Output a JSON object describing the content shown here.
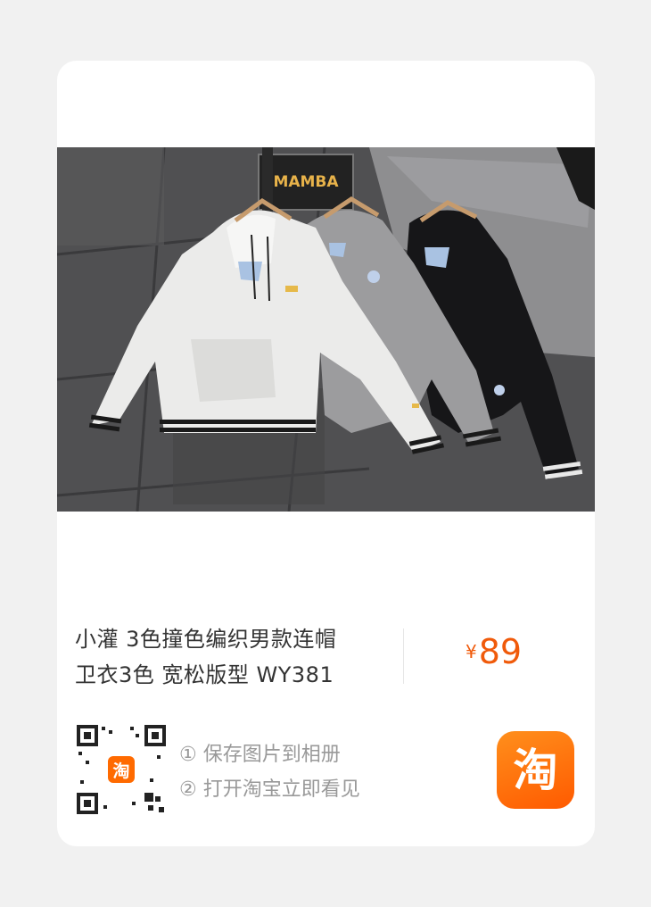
{
  "product": {
    "title_line1": "小灌 3色撞色编织男款连帽",
    "title_line2": "卫衣3色 宽松版型 WY381",
    "currency": "¥",
    "price": "89"
  },
  "photo": {
    "sign_text": "MAMBA",
    "hoodie_colors": [
      "white",
      "grey",
      "black"
    ]
  },
  "qr_code": {
    "badge_text": "淘"
  },
  "instructions": {
    "step1": "① 保存图片到相册",
    "step2": "② 打开淘宝立即看见"
  },
  "app_icon": {
    "label": "淘"
  },
  "colors": {
    "page_bg": "#f1f1f1",
    "card_bg": "#ffffff",
    "price": "#f05a0a",
    "accent_orange": "#ff6a00",
    "title_text": "#333333",
    "hint_text": "#999999"
  }
}
